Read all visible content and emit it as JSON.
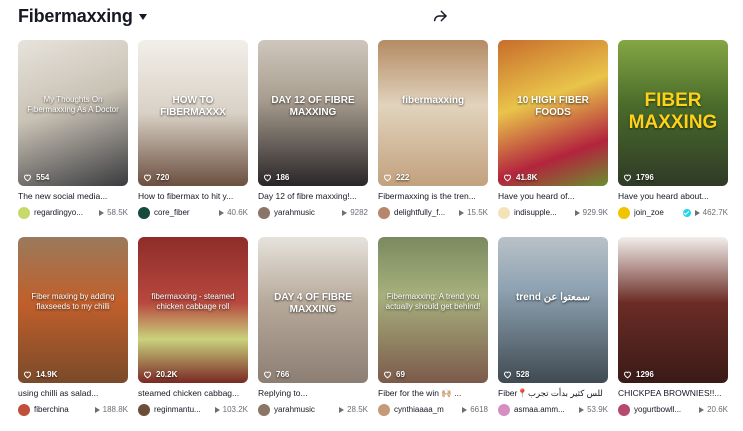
{
  "header": {
    "title": "Fibermaxxing"
  },
  "icons": {
    "share": "share-icon",
    "caret": "caret-down-icon",
    "heart": "heart-icon",
    "play": "play-icon"
  },
  "videos": [
    {
      "caption": "The new social media...",
      "author": "regardingyo...",
      "plays": "58.5K",
      "likes": "554",
      "overlay": "My Thoughts On Fibermaxxing As A Doctor",
      "bg": "linear-gradient(160deg,#e7e3dc 0%,#c9c2b5 45%,#3a3b3f 100%)",
      "avatar": "#c7d96b"
    },
    {
      "caption": "How to fibermax to hit y...",
      "author": "core_fiber",
      "plays": "40.6K",
      "likes": "720",
      "overlay": "HOW TO FIBERMAXXX",
      "bg": "linear-gradient(180deg,#f2efe9 0%,#d9d1c6 50%,#6b4f3f 100%)",
      "avatar": "#164a3c"
    },
    {
      "caption": "Day 12 of fibre maxxing!...",
      "author": "yarahmusic",
      "plays": "9282",
      "likes": "186",
      "overlay": "DAY 12 OF FIBRE MAXXING",
      "bg": "linear-gradient(180deg,#cfc7bd 0%,#a99e90 40%,#2a2628 100%)",
      "avatar": "#8a7566"
    },
    {
      "caption": "Fibermaxxing is the tren...",
      "author": "delightfully_f...",
      "plays": "15.5K",
      "likes": "222",
      "overlay": "fibermaxxing",
      "bg": "linear-gradient(180deg,#b48b64 0%,#e1d3bd 45%,#c2a17d 100%)",
      "avatar": "#b6876a"
    },
    {
      "caption": "Have you heard of...",
      "author": "indisupple...",
      "plays": "929.9K",
      "likes": "41.8K",
      "overlay": "10 HIGH FIBER FOODS",
      "bg": "linear-gradient(160deg,#c86d2c 0%,#e9c44a 40%,#b3243d 75%,#6a8f2f 100%)",
      "avatar": "#f4e3b8"
    },
    {
      "caption": "Have you heard about...",
      "author": "join_zoe",
      "plays": "462.7K",
      "likes": "1796",
      "overlay": "FIBER MAXXING",
      "bg": "linear-gradient(180deg,#85a644 0%,#496b2a 45%,#2f3a27 100%)",
      "avatar": "#f2c400",
      "verified": true
    },
    {
      "caption": "using chilli as salad...",
      "author": "fiberchina",
      "plays": "188.8K",
      "likes": "14.9K",
      "overlay": "Fiber maxing by adding flaxseeds to my chilli",
      "bg": "linear-gradient(180deg,#9a7a5c 0%,#c15f2b 45%,#7a4a2a 100%)",
      "avatar": "#c0503b"
    },
    {
      "caption": "steamed chicken cabbag...",
      "author": "reginmantu...",
      "plays": "103.2K",
      "likes": "20.2K",
      "overlay": "fibermaxxing - steamed chicken cabbage roll",
      "bg": "linear-gradient(180deg,#8e2d2a 0%,#b7483e 45%,#c9d27d 70%,#7a2824 100%)",
      "avatar": "#6b4d3a"
    },
    {
      "caption": "Replying to...",
      "author": "yarahmusic",
      "plays": "28.5K",
      "likes": "766",
      "overlay": "DAY 4 OF FIBRE MAXXING",
      "bg": "linear-gradient(180deg,#e6e2dc 0%,#b6a99a 45%,#8d7e74 100%)",
      "avatar": "#8a7566"
    },
    {
      "caption": "Fiber for the win 🙌🏼 ...",
      "author": "cynthiaaaa_m",
      "plays": "6618",
      "likes": "69",
      "overlay": "Fibermaxxing: A trend you actually should get behind!",
      "bg": "linear-gradient(180deg,#7a8a5f 0%,#a7b07d 40%,#7c5a4b 100%)",
      "avatar": "#c49a7a"
    },
    {
      "caption": "Fiber📍للس كثير بدأت تجرب",
      "author": "asmaa.amm...",
      "plays": "53.9K",
      "likes": "528",
      "overlay": "trend سمعتوا عن",
      "bg": "linear-gradient(180deg,#b9c2c7 0%,#8fa3b3 35%,#3f4a52 100%)",
      "avatar": "#d58ec0"
    },
    {
      "caption": "CHICKPEA BROWNIES!!...",
      "author": "yogurtbowll...",
      "plays": "20.6K",
      "likes": "1296",
      "overlay": "",
      "bg": "linear-gradient(180deg,#f2eeea 0%,#6b2c25 45%,#3a1a17 100%)",
      "avatar": "#b64a6e"
    }
  ]
}
